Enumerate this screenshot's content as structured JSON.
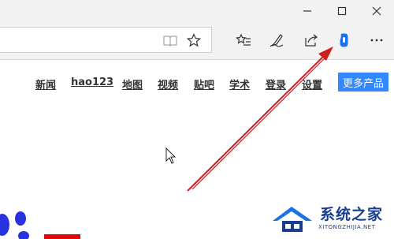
{
  "window": {
    "minimize_icon": "minimize-icon",
    "maximize_icon": "maximize-icon",
    "close_icon": "close-icon"
  },
  "toolbar": {
    "icons": [
      "reading-view-icon",
      "favorite-star-icon",
      "favorites-hub-icon",
      "web-note-icon",
      "share-icon",
      "extension-icon",
      "more-menu-icon"
    ],
    "accent": "#1a73e8"
  },
  "baidu_nav": {
    "links": [
      "新闻",
      "hao123",
      "地图",
      "视频",
      "贴吧",
      "学术",
      "登录",
      "设置"
    ],
    "more_label": "更多产品",
    "more_color": "#3388ff"
  },
  "annotation": {
    "arrow_color": "#cc1f1f"
  },
  "watermark": {
    "title": "系统之家",
    "subtitle": "XITONGZHIJIA.NET"
  }
}
